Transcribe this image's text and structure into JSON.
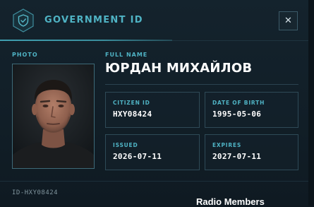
{
  "header": {
    "title": "GOVERNMENT ID",
    "close_label": "✕"
  },
  "photo": {
    "label": "PHOTO"
  },
  "name": {
    "label": "FULL NAME",
    "value": "ЮРДАН МИХАЙЛОВ"
  },
  "fields": {
    "citizen_id": {
      "label": "CITIZEN ID",
      "value": "HXY08424"
    },
    "date_of_birth": {
      "label": "DATE OF BIRTH",
      "value": "1995-05-06"
    },
    "issued": {
      "label": "ISSUED",
      "value": "2026-07-11"
    },
    "expires": {
      "label": "EXPIRES",
      "value": "2027-07-11"
    }
  },
  "footer": {
    "id_text": "ID-HXY08424"
  },
  "background_overlay": {
    "text": "Radio Members"
  },
  "colors": {
    "accent": "#4fb3c4",
    "background": "#111e27",
    "border": "#2e4a57",
    "text": "#ffffff"
  },
  "icons": {
    "badge": "shield-check-icon",
    "close": "close-icon"
  }
}
